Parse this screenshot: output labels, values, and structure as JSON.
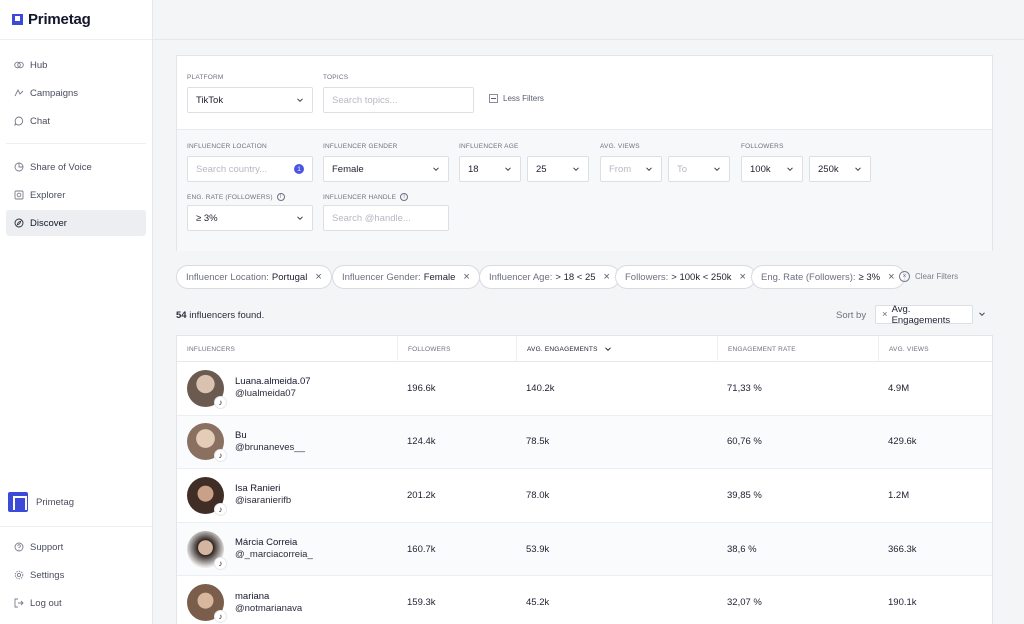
{
  "brand": {
    "name": "Primetag"
  },
  "sidebar": {
    "items": [
      {
        "label": "Hub",
        "icon": "hub-icon"
      },
      {
        "label": "Campaigns",
        "icon": "campaigns-icon"
      },
      {
        "label": "Chat",
        "icon": "chat-icon"
      },
      {
        "label": "Share of Voice",
        "icon": "share-of-voice-icon"
      },
      {
        "label": "Explorer",
        "icon": "explorer-icon"
      },
      {
        "label": "Discover",
        "icon": "compass-icon",
        "active": true
      }
    ],
    "org_name": "Primetag",
    "bottom_items": [
      {
        "label": "Support",
        "icon": "help-icon"
      },
      {
        "label": "Settings",
        "icon": "gear-icon"
      },
      {
        "label": "Log out",
        "icon": "logout-icon"
      }
    ]
  },
  "filters": {
    "platform": {
      "label": "PLATFORM",
      "value": "TikTok"
    },
    "topics": {
      "label": "TOPICS",
      "placeholder": "Search topics..."
    },
    "less_filters": "Less Filters",
    "location": {
      "label": "INFLUENCER LOCATION",
      "placeholder": "Search country...",
      "count": "1"
    },
    "gender": {
      "label": "INFLUENCER GENDER",
      "value": "Female"
    },
    "age": {
      "label": "INFLUENCER AGE",
      "from": "18",
      "to": "25"
    },
    "views": {
      "label": "AVG. VIEWS",
      "from": "From",
      "to": "To"
    },
    "followers": {
      "label": "FOLLOWERS",
      "from": "100k",
      "to": "250k"
    },
    "eng_rate": {
      "label": "ENG. RATE (FOLLOWERS)",
      "value": "≥ 3%"
    },
    "handle": {
      "label": "INFLUENCER HANDLE",
      "placeholder": "Search @handle..."
    }
  },
  "chips": [
    {
      "key": "Influencer Location:",
      "value": "Portugal"
    },
    {
      "key": "Influencer Gender:",
      "value": "Female"
    },
    {
      "key": "Influencer Age:",
      "value": "> 18 < 25"
    },
    {
      "key": "Followers:",
      "value": "> 100k < 250k"
    },
    {
      "key": "Eng. Rate (Followers):",
      "value": "≥ 3%"
    }
  ],
  "clear_filters": "Clear Filters",
  "results": {
    "count": "54",
    "suffix": "influencers found."
  },
  "sort": {
    "label": "Sort by",
    "value": "Avg. Engagements"
  },
  "table": {
    "headers": [
      "INFLUENCERS",
      "FOLLOWERS",
      "AVG. ENGAGEMENTS",
      "ENGAGEMENT RATE",
      "AVG. VIEWS"
    ],
    "rows": [
      {
        "name": "Luana.almeida.07",
        "handle": "@lualmeida07",
        "followers": "196.6k",
        "engagements": "140.2k",
        "rate": "71,33 %",
        "views": "4.9M",
        "avatar_color": "#6b5a50"
      },
      {
        "name": "Bu",
        "handle": "@brunaneves__",
        "followers": "124.4k",
        "engagements": "78.5k",
        "rate": "60,76 %",
        "views": "429.6k",
        "avatar_color": "#b89a84"
      },
      {
        "name": "Isa Ranieri",
        "handle": "@isaranierifb",
        "followers": "201.2k",
        "engagements": "78.0k",
        "rate": "39,85 %",
        "views": "1.2M",
        "avatar_color": "#5a4238"
      },
      {
        "name": "Márcia Correia",
        "handle": "@_marciacorreia_",
        "followers": "160.7k",
        "engagements": "53.9k",
        "rate": "38,6 %",
        "views": "366.3k",
        "avatar_color": "#4a3a33"
      },
      {
        "name": "mariana",
        "handle": "@notmarianava",
        "followers": "159.3k",
        "engagements": "45.2k",
        "rate": "32,07 %",
        "views": "190.1k",
        "avatar_color": "#8a6a55"
      }
    ]
  },
  "colors": {
    "accent": "#3b4bd8",
    "badge": "#4b56e0"
  }
}
